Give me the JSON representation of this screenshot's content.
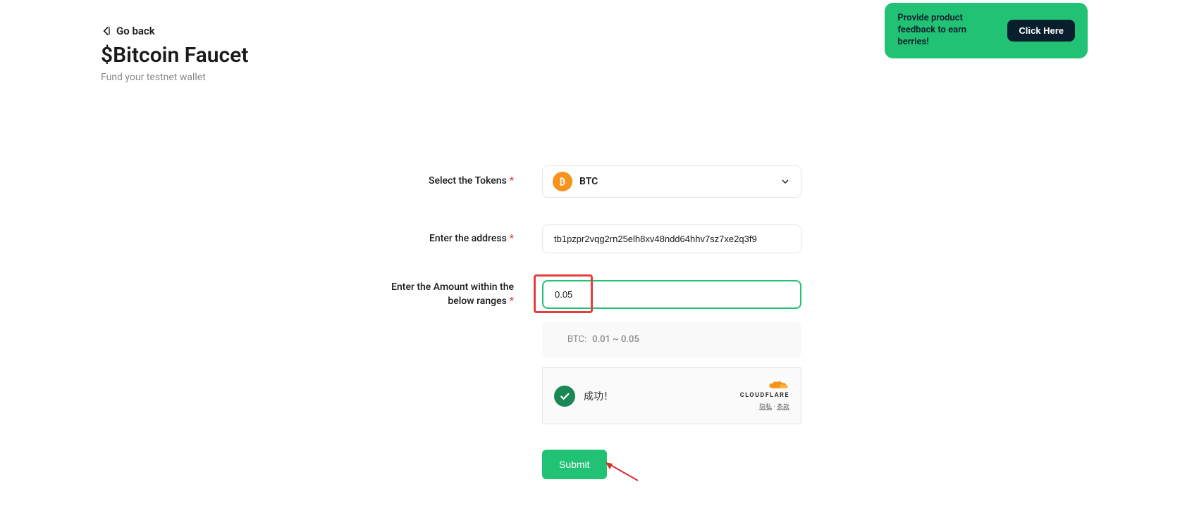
{
  "header": {
    "go_back_label": "Go back",
    "title": "$Bitcoin Faucet",
    "subtitle": "Fund your testnet wallet"
  },
  "feedback": {
    "text": "Provide product feedback to earn berries!",
    "button_label": "Click Here"
  },
  "form": {
    "token_label": "Select the Tokens",
    "token_selected": "BTC",
    "token_icon": "bitcoin-icon",
    "address_label": "Enter the address",
    "address_value": "tb1pzpr2vqg2rn25elh8xv48ndd64hhv7sz7xe2q3f9",
    "amount_label": "Enter the Amount within the below ranges",
    "amount_value": "0.05",
    "range_label": "BTC:",
    "range_value": "0.01 ~ 0.05",
    "captcha_success": "成功！",
    "cloudflare_label": "CLOUDFLARE",
    "cloudflare_privacy": "隐私",
    "cloudflare_separator": " · ",
    "cloudflare_terms": "条款",
    "submit_label": "Submit"
  }
}
